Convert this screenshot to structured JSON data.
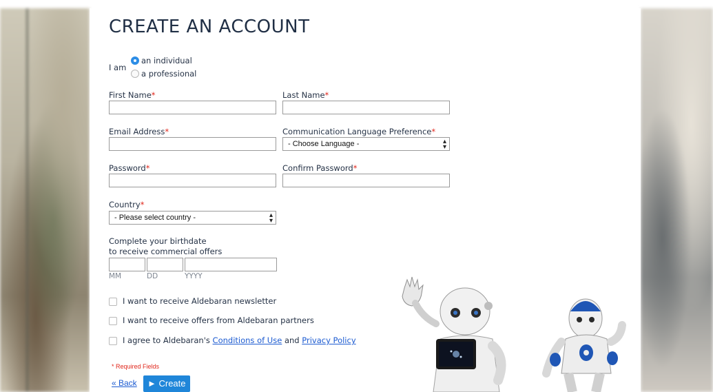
{
  "page": {
    "title": "CREATE AN ACCOUNT"
  },
  "account_type": {
    "label": "I am",
    "options": [
      "an individual",
      "a professional"
    ],
    "selected": "an individual"
  },
  "fields": {
    "first_name": {
      "label": "First Name",
      "required_mark": "*",
      "value": ""
    },
    "last_name": {
      "label": "Last Name",
      "required_mark": "*",
      "value": ""
    },
    "email": {
      "label": "Email Address",
      "required_mark": "*",
      "value": ""
    },
    "language": {
      "label": "Communication Language Preference",
      "required_mark": "*",
      "selected": "- Choose Language -"
    },
    "password": {
      "label": "Password",
      "required_mark": "*",
      "value": ""
    },
    "confirm_password": {
      "label": "Confirm Password",
      "required_mark": "*",
      "value": ""
    },
    "country": {
      "label": "Country",
      "required_mark": "*",
      "selected": "- Please select country -"
    }
  },
  "birthdate": {
    "label_line1": "Complete your birthdate",
    "label_line2": "to receive commercial offers",
    "mm": "MM",
    "dd": "DD",
    "yyyy": "YYYY"
  },
  "checkboxes": {
    "newsletter": "I want to receive Aldebaran newsletter",
    "partners": "I want to receive offers from Aldebaran partners",
    "agree_prefix": "I agree to Aldebaran's",
    "conditions_link": "Conditions of Use",
    "agree_and": "and",
    "privacy_link": "Privacy Policy"
  },
  "footer": {
    "required_note": "* Required Fields",
    "back": "« Back",
    "create": "► Create"
  },
  "colors": {
    "accent": "#1f86d9",
    "required": "#e0261b",
    "link": "#1c5bd1"
  }
}
